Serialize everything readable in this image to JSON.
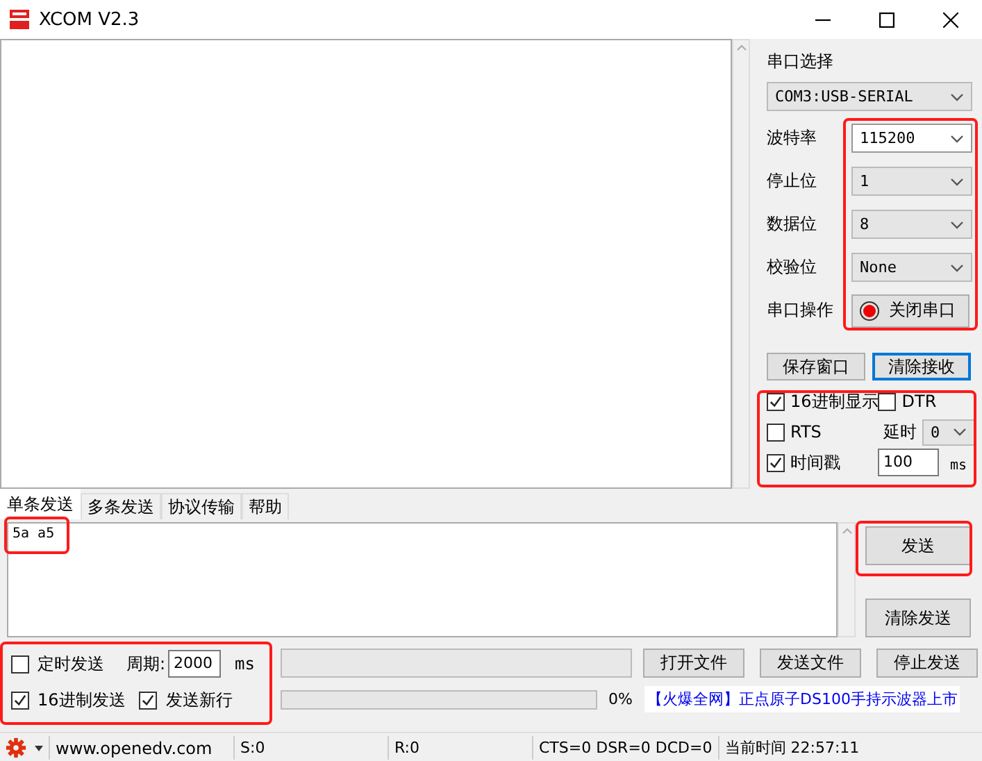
{
  "window": {
    "title": "XCOM V2.3"
  },
  "port_panel": {
    "heading": "串口选择",
    "port": "COM3:USB-SERIAL",
    "settings": [
      {
        "label": "波特率",
        "value": "115200",
        "highlighted": true
      },
      {
        "label": "停止位",
        "value": "1",
        "highlighted": false
      },
      {
        "label": "数据位",
        "value": "8",
        "highlighted": false
      },
      {
        "label": "校验位",
        "value": "None",
        "highlighted": false
      }
    ],
    "operation_label": "串口操作",
    "port_button": {
      "label": "关闭串口",
      "on": true
    }
  },
  "receive_buttons": [
    {
      "label": "保存窗口",
      "focused": false
    },
    {
      "label": "清除接收",
      "focused": true
    }
  ],
  "receive_options": {
    "hex_display": {
      "label": "16进制显示",
      "checked": true
    },
    "dtr": {
      "label": "DTR",
      "checked": false
    },
    "rts": {
      "label": "RTS",
      "checked": false
    },
    "delay": {
      "label": "延时",
      "value": "0"
    },
    "timestamp": {
      "label": "时间戳",
      "checked": true
    },
    "timestamp_value": "100",
    "timestamp_unit": "ms"
  },
  "tabs": [
    {
      "label": "单条发送",
      "selected": true
    },
    {
      "label": "多条发送",
      "selected": false
    },
    {
      "label": "协议传输",
      "selected": false
    },
    {
      "label": "帮助",
      "selected": false
    }
  ],
  "send": {
    "text": "5a a5",
    "send_button": "发送",
    "clear_button": "清除发送"
  },
  "send_options": {
    "timed_send": {
      "label": "定时发送",
      "checked": false
    },
    "period_label": "周期:",
    "period_value": "2000",
    "period_unit": "ms",
    "hex_send": {
      "label": "16进制发送",
      "checked": true
    },
    "newline": {
      "label": "发送新行",
      "checked": true
    }
  },
  "file_buttons": [
    "打开文件",
    "发送文件",
    "停止发送"
  ],
  "progress": {
    "reading": "0%"
  },
  "ad_link": "【火爆全网】正点原子DS100手持示波器上市",
  "status_bar": {
    "website": "www.openedv.com",
    "sent": "S:0",
    "received": "R:0",
    "lines": "CTS=0 DSR=0 DCD=0",
    "time": "当前时间 22:57:11"
  }
}
